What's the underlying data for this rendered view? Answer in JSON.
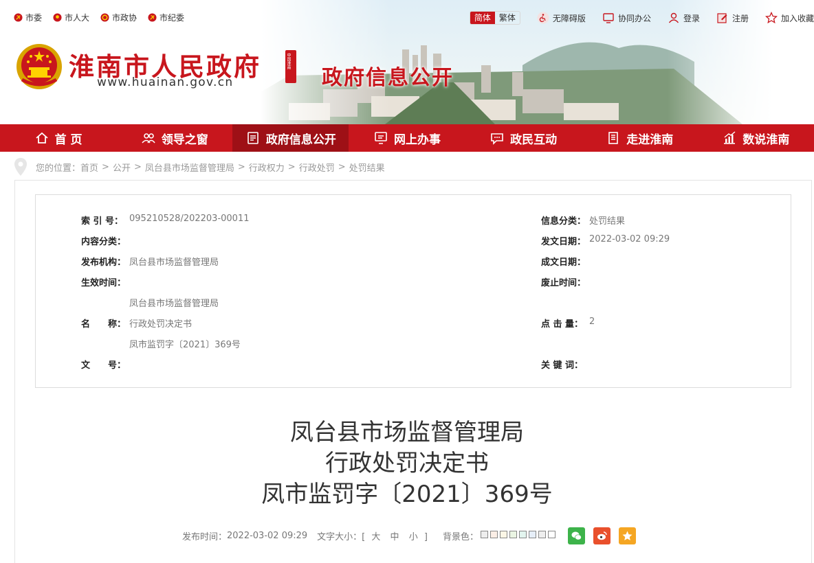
{
  "top_links": [
    {
      "label": "市委",
      "icon": "party-emblem-icon"
    },
    {
      "label": "市人大",
      "icon": "national-emblem-icon"
    },
    {
      "label": "市政协",
      "icon": "cppcc-emblem-icon"
    },
    {
      "label": "市纪委",
      "icon": "party-emblem-icon"
    }
  ],
  "top_right": {
    "lang_simplified": "简体",
    "lang_traditional": "繁体",
    "accessibility": "无障碍版",
    "office": "协同办公",
    "login": "登录",
    "register": "注册",
    "favorite": "加入收藏"
  },
  "header": {
    "site_name": "淮南市人民政府",
    "site_url": "www.huainan.gov.cn",
    "seal_text": "中国淮南",
    "section_title": "政府信息公开"
  },
  "nav": [
    {
      "label": "首 页",
      "icon": "home-icon"
    },
    {
      "label": "领导之窗",
      "icon": "people-icon"
    },
    {
      "label": "政府信息公开",
      "icon": "document-list-icon",
      "active": true
    },
    {
      "label": "网上办事",
      "icon": "monitor-icon"
    },
    {
      "label": "政民互动",
      "icon": "chat-icon"
    },
    {
      "label": "走进淮南",
      "icon": "building-icon"
    },
    {
      "label": "数说淮南",
      "icon": "bar-chart-icon"
    }
  ],
  "breadcrumb": {
    "prefix": "您的位置：",
    "items": [
      "首页",
      "公开",
      "凤台县市场监督管理局",
      "行政权力",
      "行政处罚",
      "处罚结果"
    ]
  },
  "meta": {
    "index_label": "索 引 号：",
    "index_value": "095210528/202203-00011",
    "category_label": "信息分类：",
    "category_value": "处罚结果",
    "content_type_label": "内容分类：",
    "content_type_value": "",
    "publish_date_label": "发文日期：",
    "publish_date_value": "2022-03-02 09:29",
    "agency_label": "发布机构：",
    "agency_value": "凤台县市场监督管理局",
    "written_date_label": "成文日期：",
    "written_date_value": "",
    "effective_label": "生效时间：",
    "effective_value": "",
    "expire_label": "废止时间：",
    "expire_value": "",
    "name_label": "名　　称：",
    "name_line1": "凤台县市场监督管理局",
    "name_line2": "行政处罚决定书",
    "name_line3": "凤市监罚字〔2021〕369号",
    "clicks_label": "点 击 量：",
    "clicks_value": "2",
    "docno_label": "文　　号：",
    "docno_value": "",
    "keywords_label": "关 键 词：",
    "keywords_value": ""
  },
  "document": {
    "title_line1": "凤台县市场监督管理局",
    "title_line2": "行政处罚决定书",
    "title_line3": "凤市监罚字〔2021〕369号"
  },
  "info_bar": {
    "publish_label": "发布时间：",
    "publish_value": "2022-03-02 09:29",
    "font_size_label": "文字大小：[",
    "font_large": "大",
    "font_medium": "中",
    "font_small": "小",
    "font_size_end": "]",
    "bg_label": "背景色：",
    "bg_colors": [
      "#eeeeee",
      "#fbeee6",
      "#fbf6e6",
      "#eaf5e3",
      "#e3f5ef",
      "#e6eef8",
      "#eeeeee",
      "#ffffff"
    ],
    "share_wechat_color": "#3db34a",
    "share_weibo_color": "#e9502c",
    "share_qzone_color": "#f5a623"
  },
  "brand_color": "#c8161d"
}
